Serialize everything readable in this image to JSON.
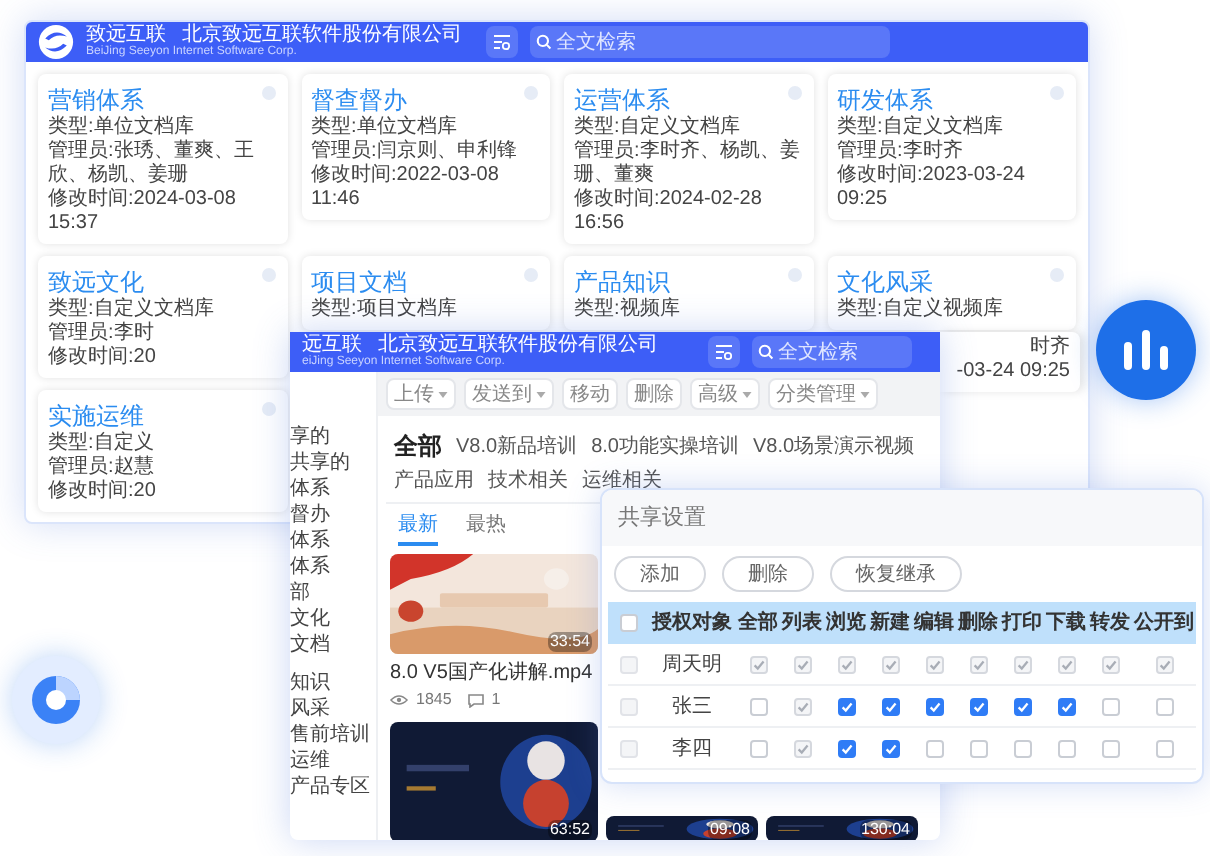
{
  "back_window": {
    "brand": "致远互联",
    "company": "北京致远互联软件股份有限公司",
    "subtitle": "BeiJing Seeyon Internet Software Corp.",
    "search": {
      "placeholder": "全文检索"
    },
    "library_rows": [
      [
        {
          "title": "营销体系",
          "lines": [
            "类型:单位文档库",
            "管理员:张琇、董爽、王欣、杨凯、姜珊",
            "修改时间:2024-03-08 15:37"
          ]
        },
        {
          "title": "督查督办",
          "lines": [
            "类型:单位文档库",
            "管理员:闫京则、申利锋",
            "修改时间:2022-03-08 11:46"
          ]
        },
        {
          "title": "运营体系",
          "lines": [
            "类型:自定义文档库",
            "管理员:李时齐、杨凯、姜珊、董爽",
            "修改时间:2024-02-28 16:56"
          ]
        },
        {
          "title": "研发体系",
          "lines": [
            "类型:自定义文档库",
            "管理员:李时齐",
            "修改时间:2023-03-24 09:25"
          ]
        }
      ],
      [
        {
          "title": "致远文化",
          "lines": [
            "类型:自定义文档库",
            "管理员:李时",
            "修改时间:20"
          ]
        },
        {
          "title": "项目文档",
          "lines": [
            "类型:项目文档库"
          ]
        },
        {
          "title": "产品知识",
          "lines": [
            "类型:视频库"
          ]
        },
        {
          "title": "文化风采",
          "lines": [
            "类型:自定义视频库",
            "时齐",
            "-03-24 09:25"
          ]
        }
      ],
      [
        {
          "title": "实施运维",
          "lines": [
            "类型:自定义",
            "管理员:赵慧",
            "修改时间:20"
          ]
        }
      ]
    ]
  },
  "front_window": {
    "brand": "远互联",
    "company": "北京致远互联软件股份有限公司",
    "subtitle": "eiJing Seeyon Internet Software Corp.",
    "search": {
      "placeholder": "全文检索"
    },
    "sidebar": [
      "享的",
      "共享的",
      "体系",
      "督办",
      "体系",
      "体系",
      "部",
      "文化",
      "文档",
      "知识",
      "风采",
      "售前培训",
      "运维",
      "产品专区"
    ],
    "toolbar": [
      {
        "label": "上传",
        "dropdown": true
      },
      {
        "label": "发送到",
        "dropdown": true
      },
      {
        "label": "移动",
        "dropdown": false
      },
      {
        "label": "删除",
        "dropdown": false
      },
      {
        "label": "高级",
        "dropdown": true
      },
      {
        "label": "分类管理",
        "dropdown": true
      }
    ],
    "categories": [
      {
        "label": "全部",
        "selected": true
      },
      {
        "label": "V8.0新品培训",
        "selected": false
      },
      {
        "label": "8.0功能实操培训",
        "selected": false
      },
      {
        "label": "V8.0场景演示视频",
        "selected": false
      },
      {
        "label": "产品应用",
        "selected": false
      },
      {
        "label": "技术相关",
        "selected": false
      },
      {
        "label": "运维相关",
        "selected": false
      }
    ],
    "sort_tabs": [
      {
        "label": "最新",
        "selected": true
      },
      {
        "label": "最热",
        "selected": false
      }
    ],
    "videos": [
      {
        "kind": "light",
        "duration": "33:54",
        "title": "8.0 V5国产化讲解.mp4",
        "views": "1845",
        "comments": "1"
      },
      {
        "kind": "dark",
        "duration": "63:52"
      },
      {
        "kind": "dark",
        "duration": "09:08"
      },
      {
        "kind": "dark",
        "duration": "130:04"
      }
    ]
  },
  "share_dialog": {
    "title": "共享设置",
    "buttons": [
      "添加",
      "删除",
      "恢复继承"
    ],
    "all_checked": false,
    "columns": [
      "授权对象",
      "全部",
      "列表",
      "浏览",
      "新建",
      "编辑",
      "删除",
      "打印",
      "下载",
      "转发",
      "公开到"
    ],
    "rows": [
      {
        "name": "周天明",
        "checked": false,
        "perms": [
          {
            "checked": true,
            "disabled": true
          },
          {
            "checked": true,
            "disabled": true
          },
          {
            "checked": true,
            "disabled": true
          },
          {
            "checked": true,
            "disabled": true
          },
          {
            "checked": true,
            "disabled": true
          },
          {
            "checked": true,
            "disabled": true
          },
          {
            "checked": true,
            "disabled": true
          },
          {
            "checked": true,
            "disabled": true
          },
          {
            "checked": true,
            "disabled": true
          },
          {
            "checked": true,
            "disabled": true
          }
        ]
      },
      {
        "name": "张三",
        "checked": false,
        "perms": [
          {
            "checked": false,
            "disabled": false
          },
          {
            "checked": true,
            "disabled": true
          },
          {
            "checked": true,
            "disabled": false
          },
          {
            "checked": true,
            "disabled": false
          },
          {
            "checked": true,
            "disabled": false
          },
          {
            "checked": true,
            "disabled": false
          },
          {
            "checked": true,
            "disabled": false
          },
          {
            "checked": true,
            "disabled": false
          },
          {
            "checked": false,
            "disabled": false
          },
          {
            "checked": false,
            "disabled": false
          }
        ]
      },
      {
        "name": "李四",
        "checked": false,
        "perms": [
          {
            "checked": false,
            "disabled": false
          },
          {
            "checked": true,
            "disabled": true
          },
          {
            "checked": true,
            "disabled": false
          },
          {
            "checked": true,
            "disabled": false
          },
          {
            "checked": false,
            "disabled": false
          },
          {
            "checked": false,
            "disabled": false
          },
          {
            "checked": false,
            "disabled": false
          },
          {
            "checked": false,
            "disabled": false
          },
          {
            "checked": false,
            "disabled": false
          },
          {
            "checked": false,
            "disabled": false
          }
        ]
      }
    ]
  }
}
